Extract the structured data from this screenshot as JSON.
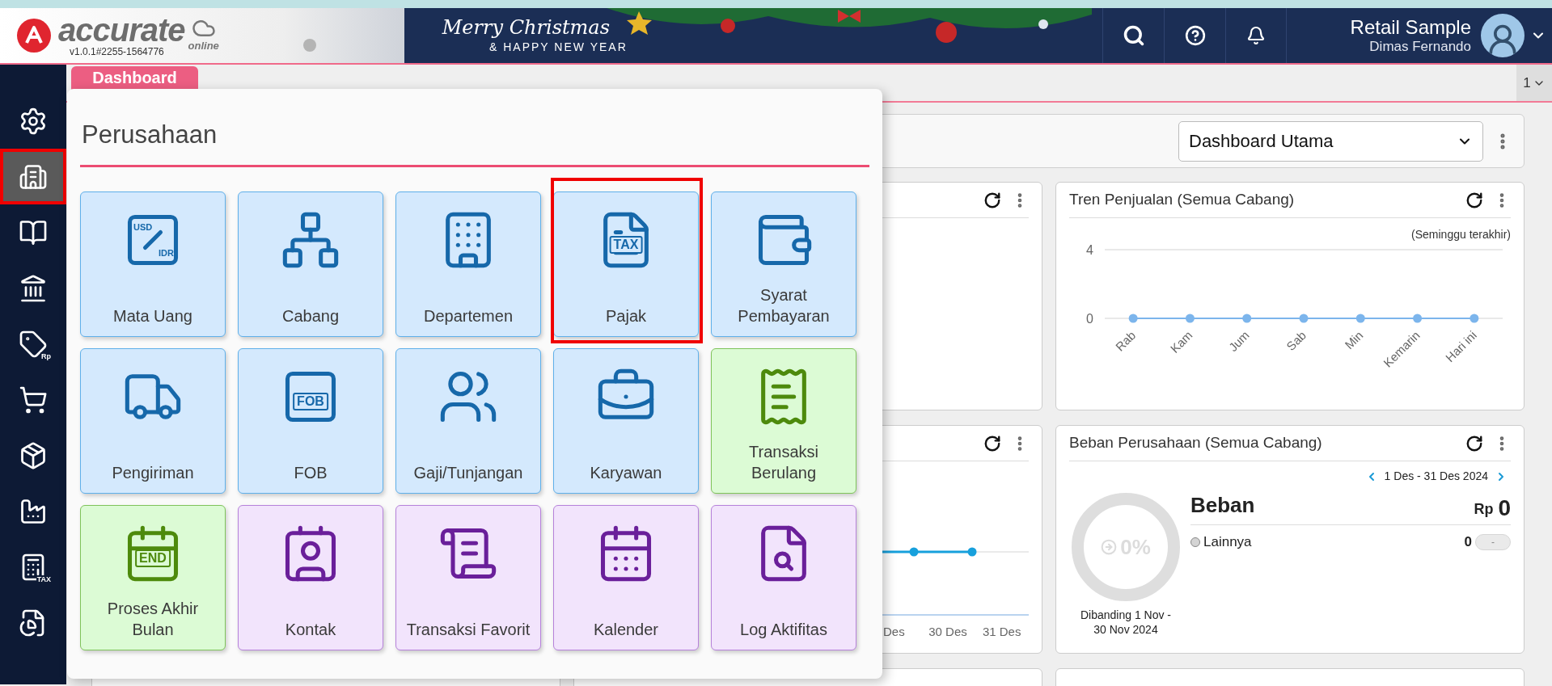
{
  "header": {
    "brand": "accurate",
    "brand_sub": "online",
    "version": "v1.0.1#2255-1564776",
    "banner_title": "Merry Christmas",
    "banner_subtitle": "& HAPPY NEW YEAR",
    "company": "Retail Sample",
    "user": "Dimas Fernando"
  },
  "sidebar": {
    "items": [
      {
        "selected": false,
        "highlighted": false
      },
      {
        "selected": true,
        "highlighted": true
      },
      {
        "selected": false,
        "highlighted": false
      },
      {
        "selected": false,
        "highlighted": false
      },
      {
        "icon_text": "Rp",
        "selected": false,
        "highlighted": false
      },
      {
        "selected": false,
        "highlighted": false
      },
      {
        "selected": false,
        "highlighted": false
      },
      {
        "selected": false,
        "highlighted": false
      },
      {
        "icon_text": "TAX",
        "selected": false,
        "highlighted": false
      },
      {
        "selected": false,
        "highlighted": false
      }
    ]
  },
  "tabs": [
    {
      "label": "Dashboard",
      "selected": true
    }
  ],
  "tab_counter": "1",
  "popup": {
    "title": "Perusahaan",
    "tiles": [
      {
        "label": "Mata Uang",
        "icon_text": [
          "USD",
          "IDR"
        ],
        "kind": "master",
        "highlighted": false
      },
      {
        "label": "Cabang",
        "kind": "master",
        "highlighted": false
      },
      {
        "label": "Departemen",
        "kind": "master",
        "highlighted": false
      },
      {
        "label": "Pajak",
        "icon_text": [
          "TAX"
        ],
        "kind": "master",
        "highlighted": true
      },
      {
        "label": "Syarat Pembayaran",
        "kind": "master",
        "highlighted": false
      },
      {
        "label": "Pengiriman",
        "kind": "master",
        "highlighted": false
      },
      {
        "label": "FOB",
        "icon_text": [
          "FOB"
        ],
        "kind": "master",
        "highlighted": false
      },
      {
        "label": "Gaji/Tunjangan",
        "kind": "master",
        "highlighted": false
      },
      {
        "label": "Karyawan",
        "kind": "master",
        "highlighted": false
      },
      {
        "label": "Transaksi Berulang",
        "kind": "process",
        "highlighted": false
      },
      {
        "label": "Proses Akhir Bulan",
        "icon_text": [
          "END"
        ],
        "kind": "process",
        "highlighted": false
      },
      {
        "label": "Kontak",
        "kind": "utility",
        "highlighted": false
      },
      {
        "label": "Transaksi Favorit",
        "kind": "utility",
        "highlighted": false
      },
      {
        "label": "Kalender",
        "kind": "utility",
        "highlighted": false
      },
      {
        "label": "Log Aktifitas",
        "kind": "utility",
        "highlighted": false
      }
    ]
  },
  "dashboard": {
    "selector": {
      "value": "Dashboard Utama"
    },
    "sales_trend": {
      "title": "Tren Penjualan (Semua Cabang)",
      "note": "(Seminggu terakhir)",
      "chart_data": {
        "type": "line",
        "categories": [
          "Rab",
          "Kam",
          "Jum",
          "Sab",
          "Min",
          "Kemarin",
          "Hari ini"
        ],
        "values": [
          0,
          0,
          0,
          0,
          0,
          0,
          0
        ],
        "marker": true,
        "ylim": [
          0,
          4
        ],
        "yticks": [
          0,
          4
        ]
      }
    },
    "partial_bottom_card": {
      "x_labels": [
        "Des",
        "30 Des",
        "31 Des"
      ]
    },
    "expenses": {
      "title": "Beban Perusahaan (Semua Cabang)",
      "period": "1 Des - 31 Des 2024",
      "ring_label": "0%",
      "compare": "Dibanding 1 Nov - 30 Nov 2024",
      "heading": "Beban",
      "currency": "Rp",
      "total": "0",
      "legend": [
        {
          "label": "Lainnya",
          "value": "0",
          "change": "-",
          "color": "#d4d4d4"
        }
      ]
    }
  }
}
